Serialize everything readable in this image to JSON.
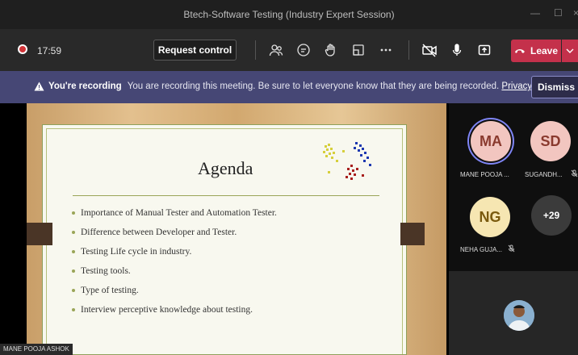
{
  "window": {
    "title": "Btech-Software Testing (Industry Expert Session)",
    "controls": [
      "—",
      "☐",
      "×"
    ]
  },
  "toolbar": {
    "timer": "17:59",
    "request_control_label": "Request control",
    "leave_label": "Leave",
    "icons": [
      "people-icon",
      "chat-icon",
      "raise-hand-icon",
      "breakout-icon",
      "more-icon",
      "camera-off-icon",
      "mic-icon",
      "share-icon"
    ]
  },
  "banner": {
    "bold": "You're recording",
    "text": "You are recording this meeting. Be sure to let everyone know that they are being recorded.",
    "link": "Privacy policy",
    "dismiss_label": "Dismiss"
  },
  "slide": {
    "title": "Agenda",
    "bullets": [
      "Importance of Manual Tester and Automation Tester.",
      "Difference between Developer and Tester.",
      "Testing Life cycle in industry.",
      "Testing tools.",
      "Type of testing.",
      "Interview perceptive knowledge about testing."
    ],
    "presenter": "MANE POOJA ASHOK"
  },
  "participants": [
    {
      "initials": "MA",
      "name": "MANE POOJA ...",
      "bg": "#f2c6c0",
      "fg": "#8a3a2e",
      "ring": "#7f85f5"
    },
    {
      "initials": "SD",
      "name": "SUGANDH...",
      "bg": "#f2c6c0",
      "fg": "#8a3a2e"
    },
    {
      "initials": "NG",
      "name": "NEHA GUJA...",
      "bg": "#f6e6b2",
      "fg": "#7a5a0e"
    },
    {
      "initials": "+29",
      "bg": "#3b3b3b",
      "fg": "#ffffff"
    }
  ],
  "colors": {
    "leave": "#c4314b",
    "banner": "#464775",
    "accent": "#7f85f5"
  }
}
